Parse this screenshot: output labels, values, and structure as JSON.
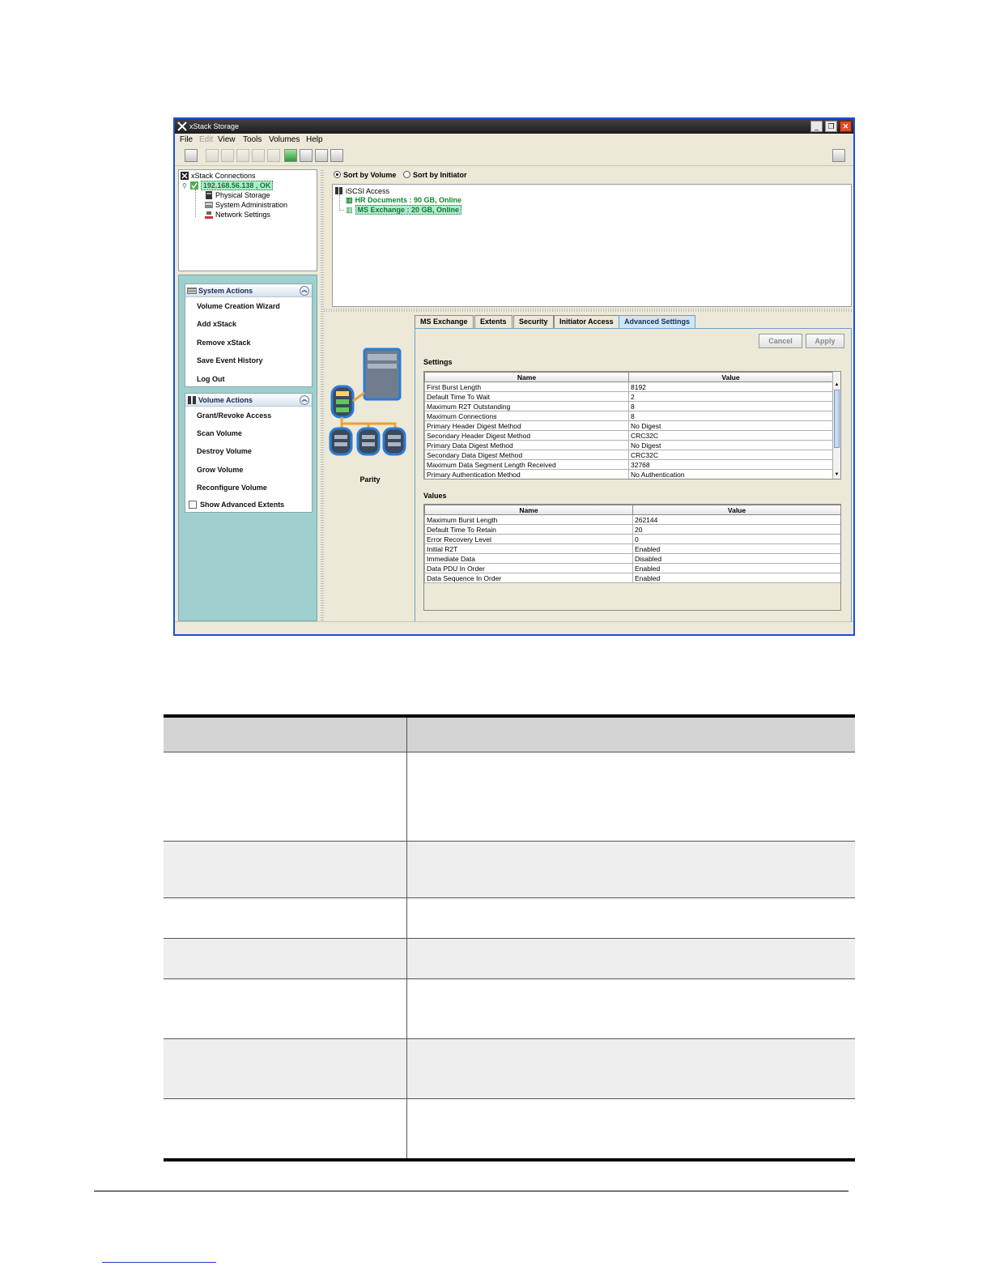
{
  "window": {
    "title": "xStack Storage",
    "minimize": "_",
    "restore": "❐",
    "close": "✕"
  },
  "menu": {
    "file": "File",
    "edit": "Edit",
    "view": "View",
    "tools": "Tools",
    "volumes": "Volumes",
    "help": "Help"
  },
  "toolbar_icons": [
    "properties-icon",
    "cut-icon",
    "copy-icon",
    "paste-icon",
    "undo-icon",
    "redo-icon",
    "iscsi-icon",
    "volume-icon",
    "disk-icon",
    "network-icon",
    "help-icon"
  ],
  "connections_tree": {
    "root": "xStack Connections",
    "host": "192.168.56.138 , OK",
    "children": [
      "Physical Storage",
      "System Administration",
      "Network Settings"
    ]
  },
  "system_actions": {
    "title": "System Actions",
    "items": [
      "Volume Creation Wizard",
      "Add xStack",
      "Remove xStack",
      "Save Event History",
      "Log Out"
    ]
  },
  "volume_actions": {
    "title": "Volume Actions",
    "items": [
      "Grant/Revoke Access",
      "Scan Volume",
      "Destroy Volume",
      "Grow Volume",
      "Reconfigure Volume"
    ],
    "show_advanced": "Show Advanced Extents"
  },
  "sort": {
    "by_volume": "Sort by Volume",
    "by_initiator": "Sort by Initiator",
    "selected": "by_volume"
  },
  "volume_tree": {
    "root": "iSCSI Access",
    "volumes": [
      "HR Documents : 90 GB, Online",
      "MS Exchange : 20 GB, Online"
    ]
  },
  "raid_label": "Parity",
  "tabs": [
    "MS Exchange",
    "Extents",
    "Security",
    "Initiator Access",
    "Advanced Settings"
  ],
  "active_tab": "Advanced Settings",
  "buttons": {
    "cancel": "Cancel",
    "apply": "Apply"
  },
  "settings": {
    "label": "Settings",
    "columns": [
      "Name",
      "Value"
    ],
    "rows": [
      [
        "First Burst Length",
        "8192"
      ],
      [
        "Default Time To Wait",
        "2"
      ],
      [
        "Maximum R2T Outstanding",
        "8"
      ],
      [
        "Maximum Connections",
        "8"
      ],
      [
        "Primary Header Digest Method",
        "No Digest"
      ],
      [
        "Secondary Header Digest Method",
        "CRC32C"
      ],
      [
        "Primary Data Digest Method",
        "No Digest"
      ],
      [
        "Secondary Data Digest Method",
        "CRC32C"
      ],
      [
        "Maximum Data Segment Length Received",
        "32768"
      ],
      [
        "Primary Authentication Method",
        "No Authentication"
      ]
    ]
  },
  "values": {
    "label": "Values",
    "columns": [
      "Name",
      "Value"
    ],
    "rows": [
      [
        "Maximum Burst Length",
        "262144"
      ],
      [
        "Default Time To Retain",
        "20"
      ],
      [
        "Error Recovery Level",
        "0"
      ],
      [
        "Initial R2T",
        "Enabled"
      ],
      [
        "Immediate Data",
        "Disabled"
      ],
      [
        "Data PDU In Order",
        "Enabled"
      ],
      [
        "Data Sequence In Order",
        "Enabled"
      ]
    ]
  }
}
